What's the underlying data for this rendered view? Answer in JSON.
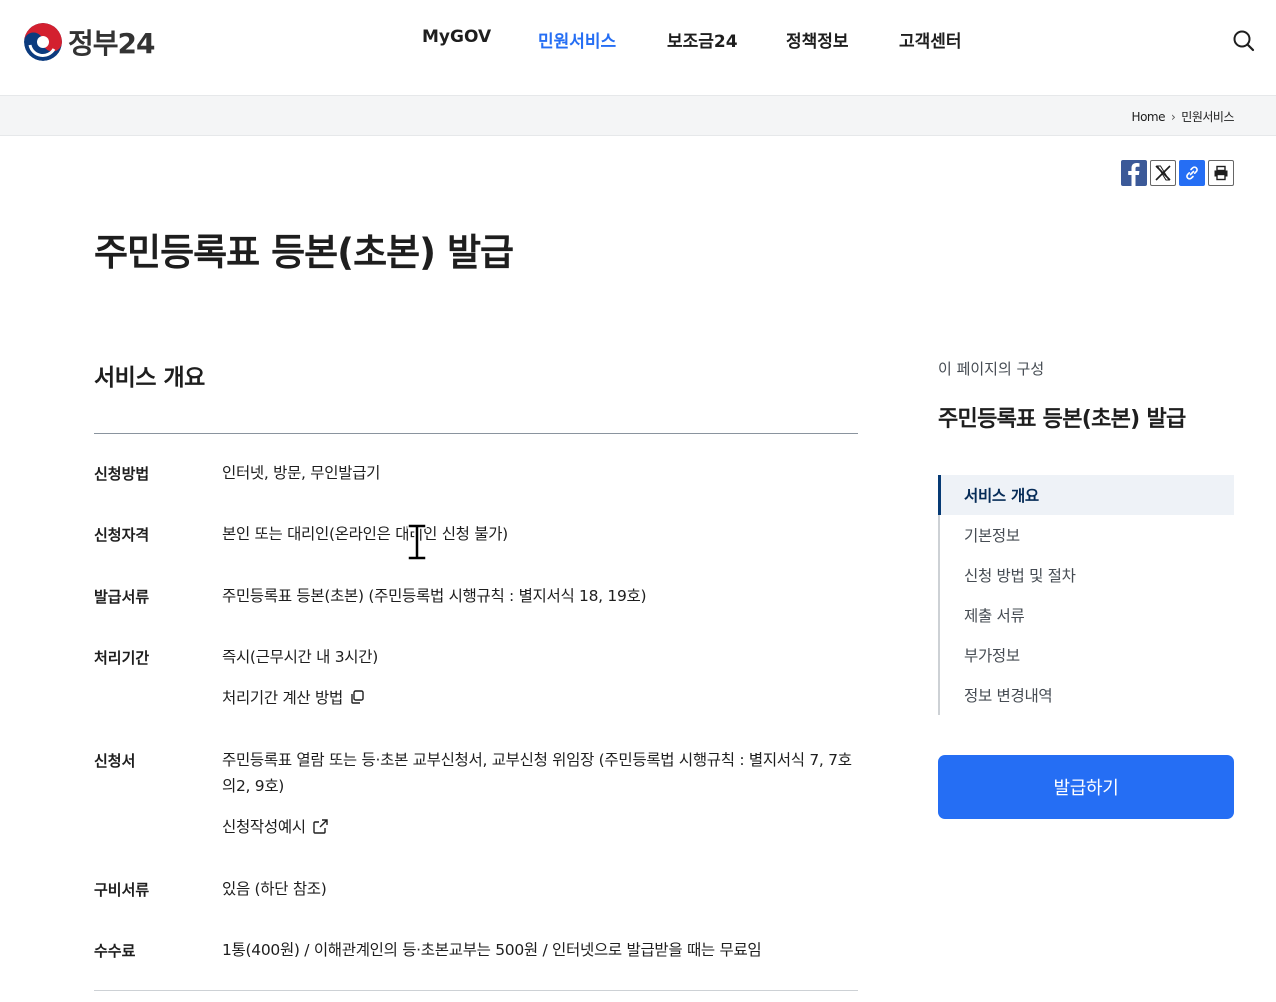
{
  "header": {
    "logo_text": "정부24",
    "nav": [
      "MyGOV",
      "민원서비스",
      "보조금24",
      "정책정보",
      "고객센터"
    ],
    "active_nav": "민원서비스",
    "search_icon": "search-icon"
  },
  "breadcrumb": {
    "home": "Home",
    "current": "민원서비스"
  },
  "share": {
    "icons": [
      "facebook-icon",
      "x-icon",
      "link-icon",
      "print-icon"
    ]
  },
  "page_title": "주민등록표 등본(초본) 발급",
  "overview": {
    "title": "서비스 개요",
    "rows": [
      {
        "label": "신청방법",
        "value": "인터넷, 방문, 무인발급기"
      },
      {
        "label": "신청자격",
        "value": "본인 또는 대리인(온라인은 대리인 신청 불가)"
      },
      {
        "label": "발급서류",
        "value": "주민등록표 등본(초본) (주민등록법 시행규칙 : 별지서식 18, 19호)"
      },
      {
        "label": "처리기간",
        "value": "즉시(근무시간 내 3시간)",
        "link": "처리기간 계산 방법"
      },
      {
        "label": "신청서",
        "value": "주민등록표 열람 또는 등·초본 교부신청서, 교부신청 위임장 (주민등록법 시행규칙 : 별지서식 7, 7호의2, 9호)",
        "link": "신청작성예시"
      },
      {
        "label": "구비서류",
        "value": "있음 (하단 참조)"
      },
      {
        "label": "수수료",
        "value": "1통(400원) / 이해관계인의 등·초본교부는 500원 / 인터넷으로 발급받을 때는 무료임"
      }
    ]
  },
  "sidebar": {
    "caption": "이 페이지의 구성",
    "title": "주민등록표 등본(초본) 발급",
    "items": [
      "서비스 개요",
      "기본정보",
      "신청 방법 및 절차",
      "제출 서류",
      "부가정보",
      "정보 변경내역"
    ],
    "active_item": "서비스 개요",
    "issue_button": "발급하기"
  },
  "colors": {
    "accent": "#256ef4",
    "navy": "#063a74",
    "text": "#1e1e1e"
  }
}
